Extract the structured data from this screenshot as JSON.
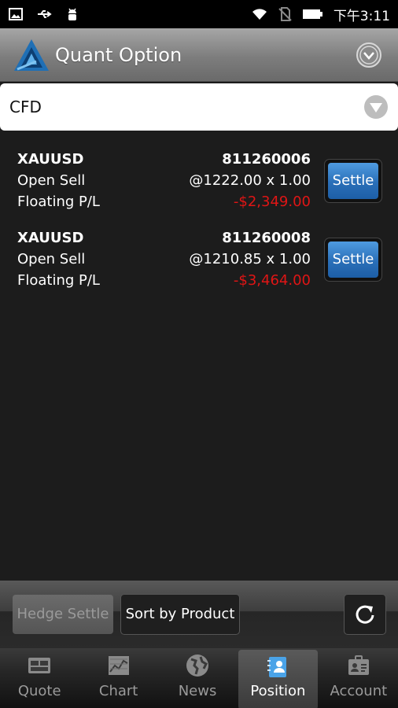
{
  "status_bar": {
    "time": "下午3:11",
    "left_icons": [
      "image-icon",
      "usb-icon",
      "android-debug-icon"
    ],
    "right_icons": [
      "wifi-icon",
      "no-sim-icon",
      "battery-icon"
    ]
  },
  "header": {
    "title": "Quant Option",
    "logo": "quant-logo-icon",
    "menu_icon": "chevron-down-circle-icon"
  },
  "category": {
    "selected": "CFD",
    "arrow_icon": "dropdown-arrow-icon"
  },
  "positions": [
    {
      "symbol": "XAUUSD",
      "order_id": "811260006",
      "side": "Open Sell",
      "price_qty": "@1222.00 x 1.00",
      "pl_label": "Floating P/L",
      "pl_value": "-$2,349.00",
      "settle_label": "Settle"
    },
    {
      "symbol": "XAUUSD",
      "order_id": "811260008",
      "side": "Open Sell",
      "price_qty": "@1210.85 x 1.00",
      "pl_label": "Floating P/L",
      "pl_value": "-$3,464.00",
      "settle_label": "Settle"
    }
  ],
  "actions": {
    "hedge_settle_label": "Hedge Settle",
    "sort_label": "Sort by Product",
    "refresh_icon": "refresh-icon"
  },
  "tabs": [
    {
      "label": "Quote",
      "icon": "quote-icon",
      "active": false
    },
    {
      "label": "Chart",
      "icon": "chart-icon",
      "active": false
    },
    {
      "label": "News",
      "icon": "globe-icon",
      "active": false
    },
    {
      "label": "Position",
      "icon": "position-icon",
      "active": true
    },
    {
      "label": "Account",
      "icon": "account-icon",
      "active": false
    }
  ],
  "colors": {
    "loss": "#e01515",
    "settle_button": "#2a6fb8",
    "background": "#1c1c1c"
  }
}
